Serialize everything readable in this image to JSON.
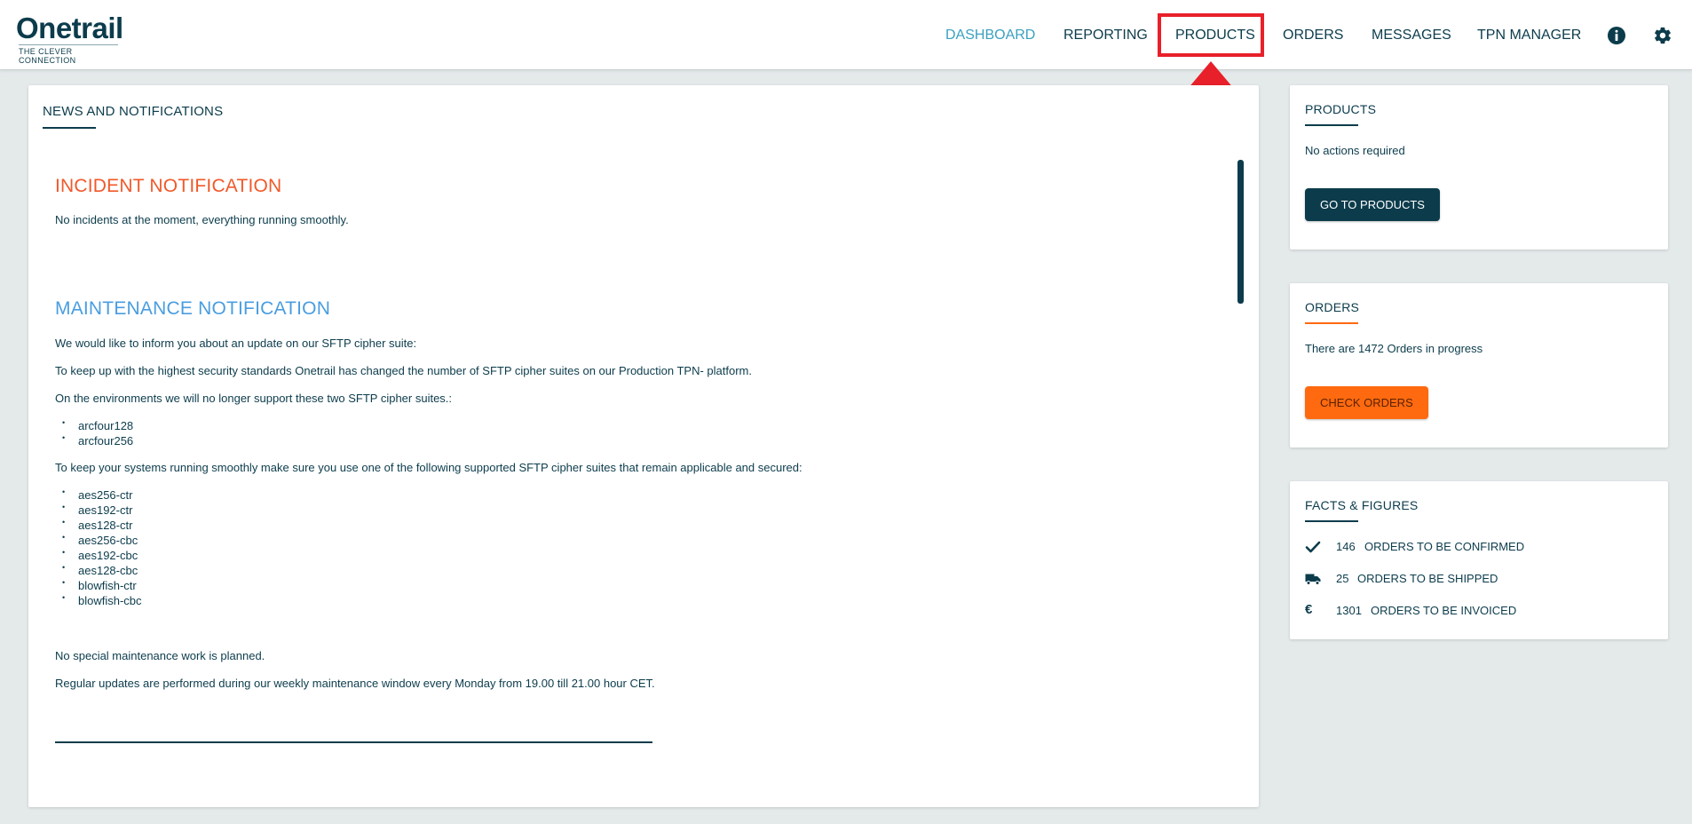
{
  "brand": {
    "name": "Onetrail",
    "tagline": "THE CLEVER CONNECTION"
  },
  "nav": {
    "items": [
      {
        "label": "DASHBOARD",
        "active": true
      },
      {
        "label": "REPORTING",
        "active": false
      },
      {
        "label": "PRODUCTS",
        "active": false,
        "highlighted": true
      },
      {
        "label": "ORDERS",
        "active": false
      },
      {
        "label": "MESSAGES",
        "active": false
      },
      {
        "label": "TPN MANAGER",
        "active": false
      }
    ],
    "icons": [
      "info-icon",
      "gear-icon"
    ]
  },
  "news": {
    "heading": "NEWS AND NOTIFICATIONS",
    "incident_title": "INCIDENT NOTIFICATION",
    "incident_text": "No incidents at the moment, everything running smoothly.",
    "maintenance_title": "MAINTENANCE NOTIFICATION",
    "maintenance_intro": "We would like to inform you about an update on our SFTP cipher suite:",
    "maintenance_p1": "To keep up with the highest security standards Onetrail has changed the number of SFTP cipher suites on our Production TPN- platform.",
    "maintenance_p2": "On the environments we will no longer support these two SFTP cipher suites.:",
    "unsupported_ciphers": [
      "arcfour128",
      "arcfour256"
    ],
    "maintenance_p3": "To keep your systems running smoothly make sure you use one of the following supported SFTP cipher suites that remain applicable and secured:",
    "supported_ciphers": [
      "aes256-ctr",
      "aes192-ctr",
      "aes128-ctr",
      "aes256-cbc",
      "aes192-cbc",
      "aes128-cbc",
      "blowfish-ctr",
      "blowfish-cbc"
    ],
    "maintenance_p4": "No special maintenance work is planned.",
    "maintenance_p5": "Regular updates are performed during our weekly maintenance window every Monday from 19.00 till 21.00 hour CET."
  },
  "products_card": {
    "heading": "PRODUCTS",
    "text": "No actions required",
    "button": "GO TO PRODUCTS"
  },
  "orders_card": {
    "heading": "ORDERS",
    "text": "There are 1472 Orders in progress",
    "button": "CHECK ORDERS"
  },
  "facts_card": {
    "heading": "FACTS & FIGURES",
    "rows": [
      {
        "icon": "check-icon",
        "count": "146",
        "label": "ORDERS TO BE CONFIRMED"
      },
      {
        "icon": "truck-icon",
        "count": "25",
        "label": "ORDERS TO BE SHIPPED"
      },
      {
        "icon": "euro-icon",
        "count": "1301",
        "label": "ORDERS TO BE INVOICED"
      }
    ]
  },
  "colors": {
    "primary": "#0c3c4c",
    "accent_blue": "#3aa1c0",
    "incident": "#f0592a",
    "maintenance": "#4a9de0",
    "orange": "#ff6a10",
    "highlight": "#e8202a"
  }
}
